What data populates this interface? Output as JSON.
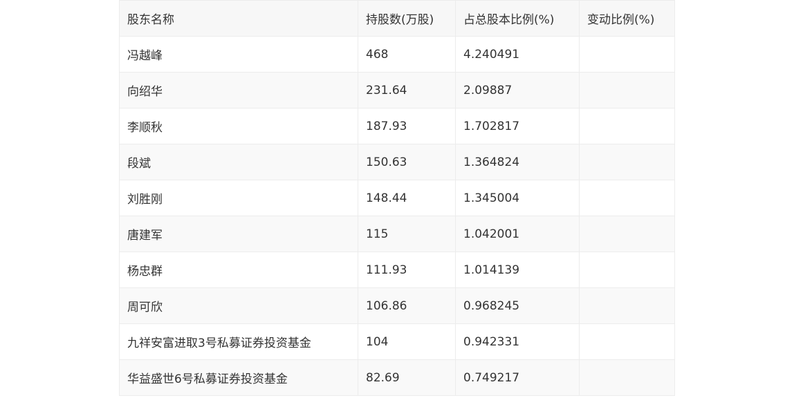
{
  "table": {
    "headers": [
      "股东名称",
      "持股数(万股)",
      "占总股本比例(%)",
      "变动比例(%)"
    ],
    "rows": [
      [
        "冯越峰",
        "468",
        "4.240491",
        ""
      ],
      [
        "向绍华",
        "231.64",
        "2.09887",
        ""
      ],
      [
        "李顺秋",
        "187.93",
        "1.702817",
        ""
      ],
      [
        "段斌",
        "150.63",
        "1.364824",
        ""
      ],
      [
        "刘胜刚",
        "148.44",
        "1.345004",
        ""
      ],
      [
        "唐建军",
        "115",
        "1.042001",
        ""
      ],
      [
        "杨忠群",
        "111.93",
        "1.014139",
        ""
      ],
      [
        "周可欣",
        "106.86",
        "0.968245",
        ""
      ],
      [
        "九祥安富进取3号私募证券投资基金",
        "104",
        "0.942331",
        ""
      ],
      [
        "华益盛世6号私募证券投资基金",
        "82.69",
        "0.749217",
        ""
      ]
    ]
  }
}
